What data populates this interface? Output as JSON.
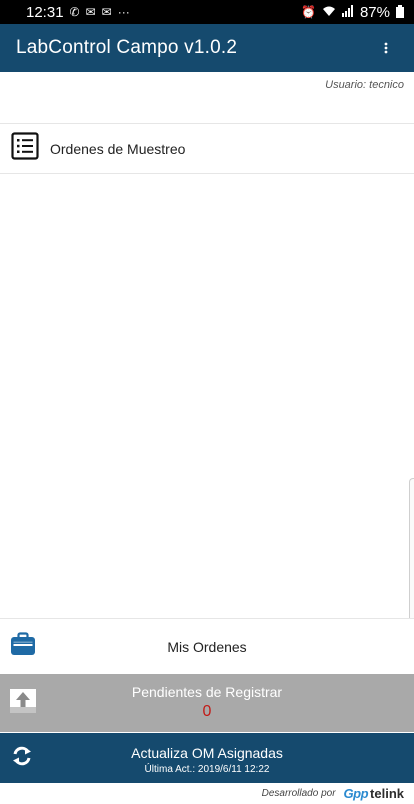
{
  "status_bar": {
    "time": "12:31",
    "battery": "87%"
  },
  "app_bar": {
    "title": "LabControl Campo v1.0.2"
  },
  "user_line": "Usuario: tecnico",
  "menu": {
    "ordenes_muestreo": "Ordenes de Muestreo"
  },
  "bottom": {
    "mis_ordenes": "Mis Ordenes",
    "pendientes_title": "Pendientes de Registrar",
    "pendientes_count": "0",
    "actualiza_title": "Actualiza OM Asignadas",
    "ultima_act": "Última  Act.: 2019/6/11 12:22"
  },
  "footer": {
    "credit": "Desarrollado por",
    "brand_gpp": "Gpp",
    "brand_telink": "telink"
  },
  "colors": {
    "primary": "#154a6e",
    "pending_bg": "#a9a9a9",
    "count_red": "#c21b17",
    "accent_blue": "#2a8ad0"
  }
}
